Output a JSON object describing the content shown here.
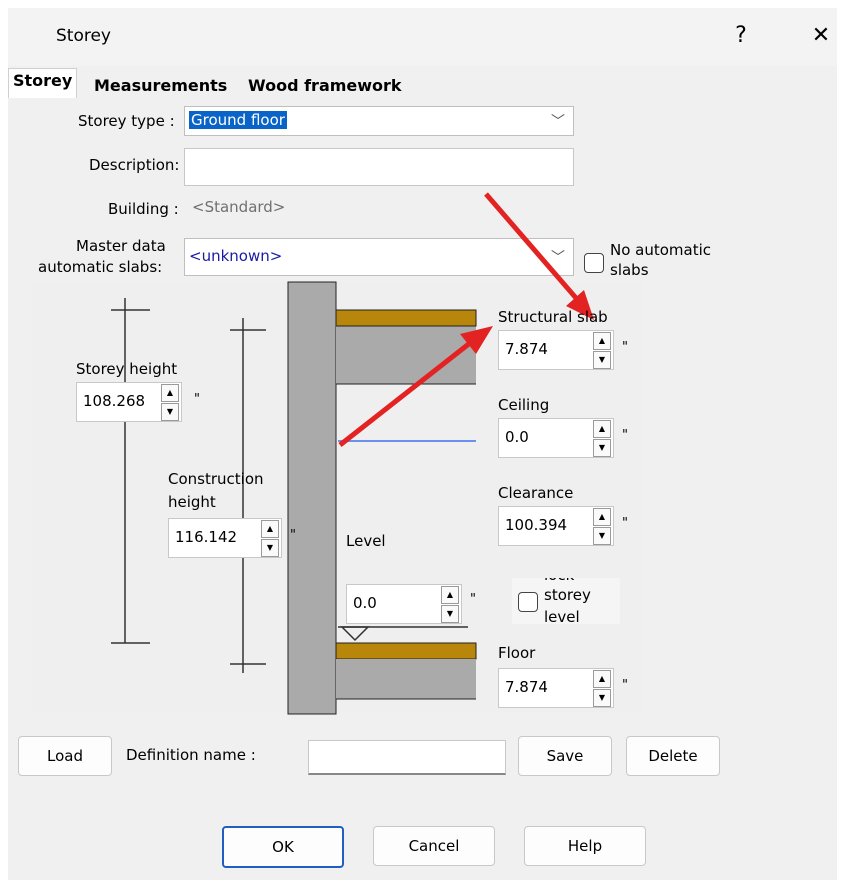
{
  "window": {
    "title": "Storey",
    "help": "?",
    "close": "✕"
  },
  "tabs": [
    "Storey",
    "Measurements",
    "Wood framework"
  ],
  "form": {
    "storey_type_label": "Storey type :",
    "storey_type_value": "Ground floor",
    "description_label": "Description:",
    "description_value": "",
    "building_label": "Building :",
    "building_value": "<Standard>",
    "master_label_1": "Master data",
    "master_label_2": "automatic slabs:",
    "master_value": "<unknown>",
    "no_auto_1": "No automatic",
    "no_auto_2": "slabs"
  },
  "measurements": {
    "storey_height_label": "Storey height",
    "storey_height": "108.268",
    "construction_height_label_1": "Construction",
    "construction_height_label_2": "height",
    "construction_height": "116.142",
    "level_label": "Level",
    "level": "0.0",
    "structural_slab_label": "Structural slab",
    "structural_slab": "7.874",
    "ceiling_label": "Ceiling",
    "ceiling": "0.0",
    "clearance_label": "Clearance",
    "clearance": "100.394",
    "floor_label": "Floor",
    "floor": "7.874",
    "unit": "\"",
    "lock_1": "lock",
    "lock_2": "storey",
    "lock_3": "level"
  },
  "definition": {
    "load": "Load",
    "name_label": "Definition name :",
    "name_value": "",
    "save": "Save",
    "delete": "Delete"
  },
  "footer": {
    "ok": "OK",
    "cancel": "Cancel",
    "help": "Help"
  },
  "colors": {
    "slab": "#b8860b",
    "wall": "#a9a9a9",
    "arrow": "#e32222",
    "level_line": "#6d8ff0",
    "selection": "#0a64c8"
  }
}
